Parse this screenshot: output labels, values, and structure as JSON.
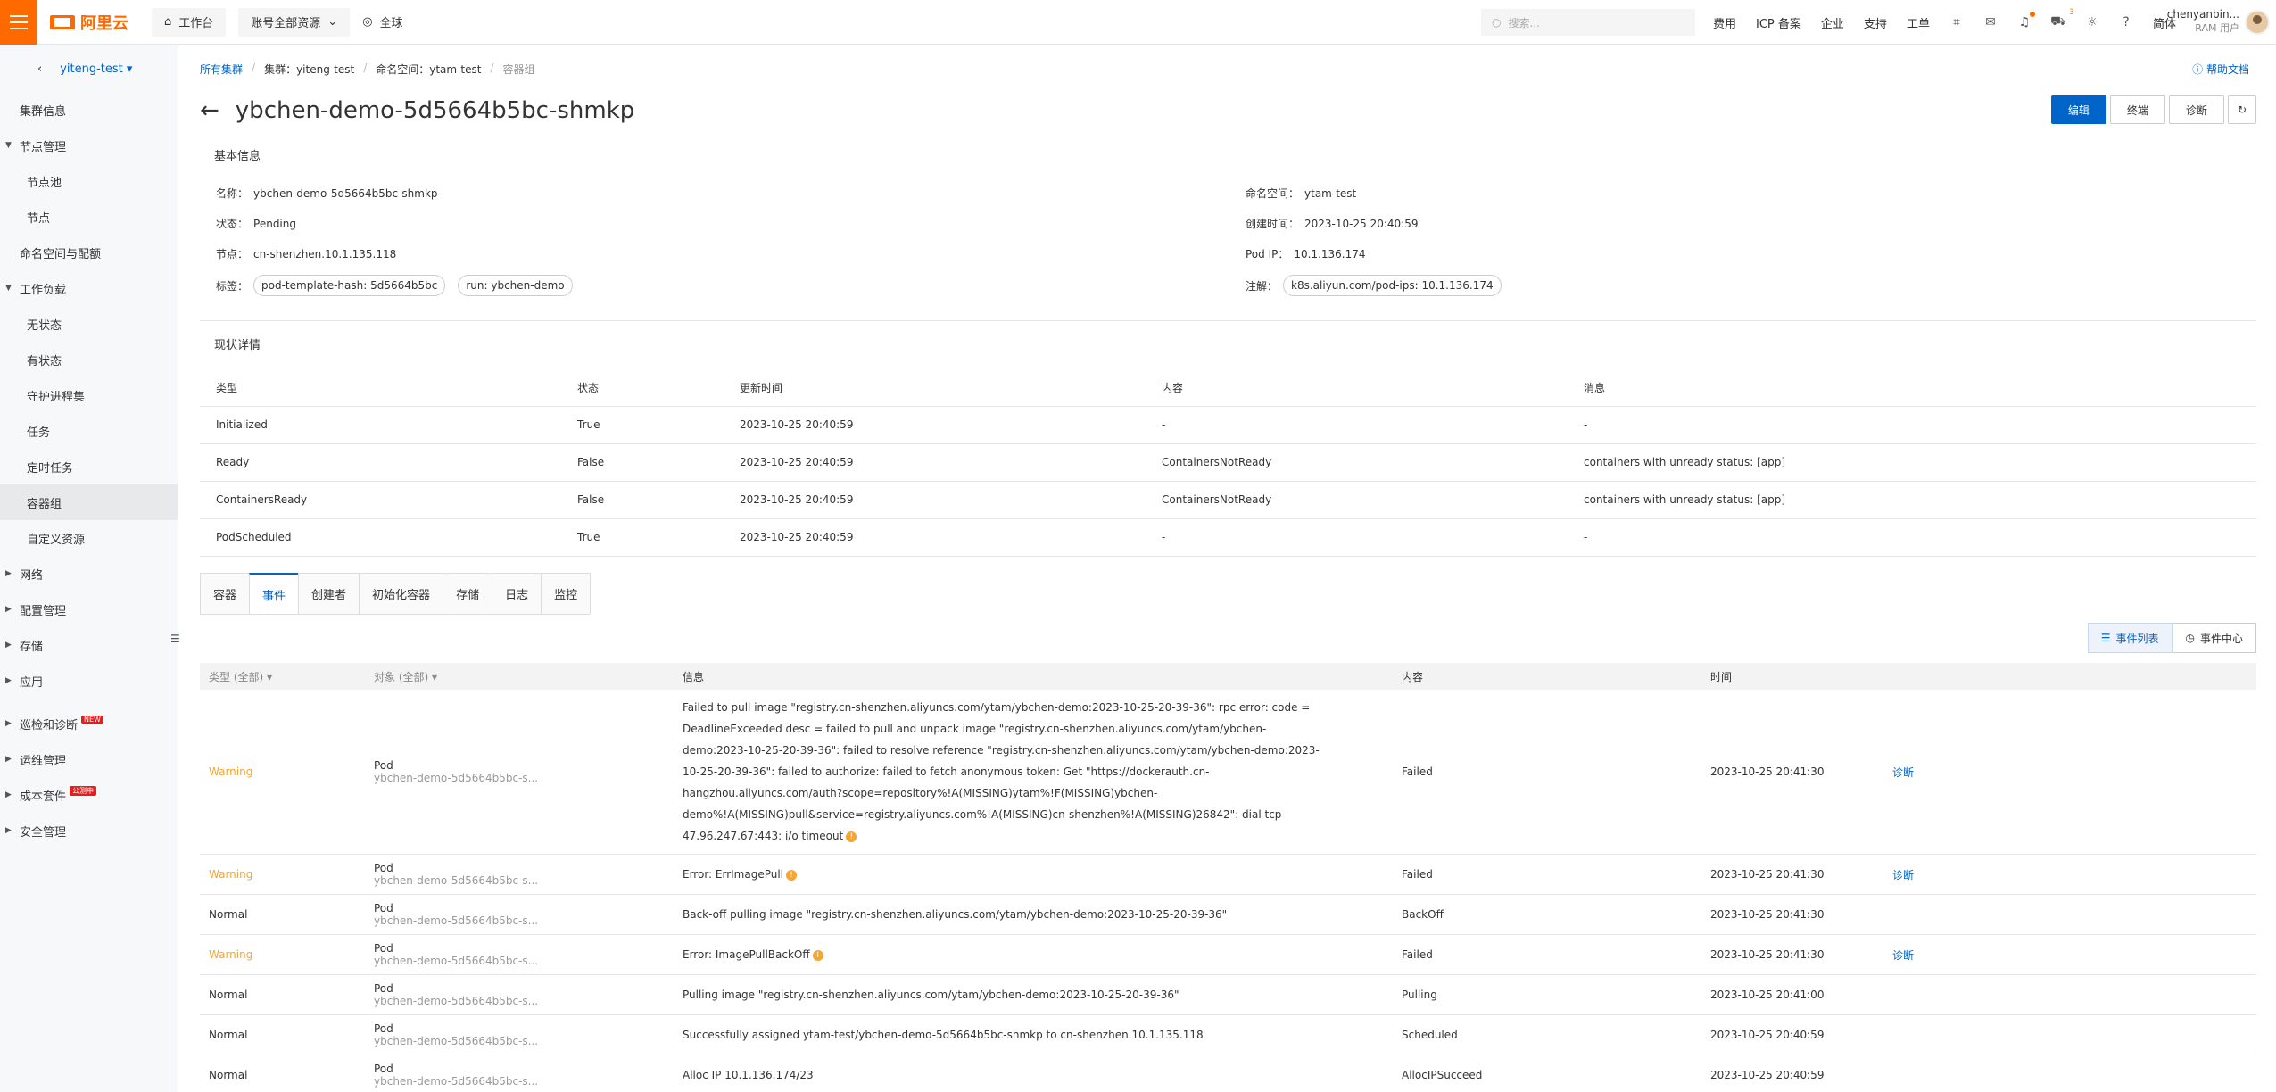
{
  "topbar": {
    "logo_text": "阿里云",
    "workbench": "工作台",
    "resource_scope": "账号全部资源",
    "region": "全球",
    "search_placeholder": "搜索...",
    "links": [
      "费用",
      "ICP 备案",
      "企业",
      "支持",
      "工单"
    ],
    "cart_count": "3",
    "lang": "简体",
    "user_name": "chenyanbin...",
    "user_role": "RAM 用户"
  },
  "sidebar": {
    "cluster": "yiteng-test",
    "items": [
      {
        "label": "集群信息"
      },
      {
        "label": "节点管理"
      },
      {
        "label": "节点池"
      },
      {
        "label": "节点"
      },
      {
        "label": "命名空间与配额"
      },
      {
        "label": "工作负载"
      },
      {
        "label": "无状态"
      },
      {
        "label": "有状态"
      },
      {
        "label": "守护进程集"
      },
      {
        "label": "任务"
      },
      {
        "label": "定时任务"
      },
      {
        "label": "容器组"
      },
      {
        "label": "自定义资源"
      },
      {
        "label": "网络"
      },
      {
        "label": "配置管理"
      },
      {
        "label": "存储"
      },
      {
        "label": "应用"
      },
      {
        "label": "巡检和诊断",
        "tag": "NEW"
      },
      {
        "label": "运维管理"
      },
      {
        "label": "成本套件",
        "tag": "公测中"
      },
      {
        "label": "安全管理"
      }
    ]
  },
  "breadcrumb": {
    "all_clusters": "所有集群",
    "cluster": "集群：yiteng-test",
    "namespace": "命名空间：ytam-test",
    "current": "容器组"
  },
  "help": "帮助文档",
  "page_title": "ybchen-demo-5d5664b5bc-shmkp",
  "actions": {
    "edit": "编辑",
    "drain": "终端",
    "diagnose": "诊断"
  },
  "basic": {
    "section_title": "基本信息",
    "name_k": "名称：",
    "name_v": "ybchen-demo-5d5664b5bc-shmkp",
    "status_k": "状态：",
    "status_v": "Pending",
    "node_k": "节点：",
    "node_v": "cn-shenzhen.10.1.135.118",
    "labels_k": "标签：",
    "labels": [
      "pod-template-hash: 5d5664b5bc",
      "run: ybchen-demo"
    ],
    "ns_k": "命名空间：",
    "ns_v": "ytam-test",
    "created_k": "创建时间：",
    "created_v": "2023-10-25 20:40:59",
    "podip_k": "Pod IP：",
    "podip_v": "10.1.136.174",
    "annot_k": "注解：",
    "annot": "k8s.aliyun.com/pod-ips: 10.1.136.174"
  },
  "conditions": {
    "section_title": "现状详情",
    "headers": [
      "类型",
      "状态",
      "更新时间",
      "内容",
      "消息"
    ],
    "rows": [
      [
        "Initialized",
        "True",
        "2023-10-25 20:40:59",
        "-",
        "-"
      ],
      [
        "Ready",
        "False",
        "2023-10-25 20:40:59",
        "ContainersNotReady",
        "containers with unready status: [app]"
      ],
      [
        "ContainersReady",
        "False",
        "2023-10-25 20:40:59",
        "ContainersNotReady",
        "containers with unready status: [app]"
      ],
      [
        "PodScheduled",
        "True",
        "2023-10-25 20:40:59",
        "-",
        "-"
      ]
    ]
  },
  "tabs": [
    "容器",
    "事件",
    "创建者",
    "初始化容器",
    "存储",
    "日志",
    "监控"
  ],
  "view_switch": {
    "list": "事件列表",
    "center": "事件中心"
  },
  "events": {
    "headers": [
      "类型 (全部)",
      "对象 (全部)",
      "信息",
      "内容",
      "时间",
      ""
    ],
    "rows": [
      {
        "type": "Warning",
        "obj": "Pod",
        "obj_sub": "ybchen-demo-5d5664b5bc-s...",
        "msg": "Failed to pull image \"registry.cn-shenzhen.aliyuncs.com/ytam/ybchen-demo:2023-10-25-20-39-36\": rpc error: code = DeadlineExceeded desc = failed to pull and unpack image \"registry.cn-shenzhen.aliyuncs.com/ytam/ybchen-demo:2023-10-25-20-39-36\": failed to resolve reference \"registry.cn-shenzhen.aliyuncs.com/ytam/ybchen-demo:2023-10-25-20-39-36\": failed to authorize: failed to fetch anonymous token: Get \"https://dockerauth.cn-hangzhou.aliyuncs.com/auth?scope=repository%!A(MISSING)ytam%!F(MISSING)ybchen-demo%!A(MISSING)pull&service=registry.aliyuncs.com%!A(MISSING)cn-shenzhen%!A(MISSING)26842\": dial tcp 47.96.247.67:443: i/o timeout",
        "content": "Failed",
        "time": "2023-10-25 20:41:30",
        "action": "诊断"
      },
      {
        "type": "Warning",
        "obj": "Pod",
        "obj_sub": "ybchen-demo-5d5664b5bc-s...",
        "msg": "Error: ErrImagePull",
        "content": "Failed",
        "time": "2023-10-25 20:41:30",
        "action": "诊断"
      },
      {
        "type": "Normal",
        "obj": "Pod",
        "obj_sub": "ybchen-demo-5d5664b5bc-s...",
        "msg": "Back-off pulling image \"registry.cn-shenzhen.aliyuncs.com/ytam/ybchen-demo:2023-10-25-20-39-36\"",
        "content": "BackOff",
        "time": "2023-10-25 20:41:30",
        "action": ""
      },
      {
        "type": "Warning",
        "obj": "Pod",
        "obj_sub": "ybchen-demo-5d5664b5bc-s...",
        "msg": "Error: ImagePullBackOff",
        "content": "Failed",
        "time": "2023-10-25 20:41:30",
        "action": "诊断"
      },
      {
        "type": "Normal",
        "obj": "Pod",
        "obj_sub": "ybchen-demo-5d5664b5bc-s...",
        "msg": "Pulling image \"registry.cn-shenzhen.aliyuncs.com/ytam/ybchen-demo:2023-10-25-20-39-36\"",
        "content": "Pulling",
        "time": "2023-10-25 20:41:00",
        "action": ""
      },
      {
        "type": "Normal",
        "obj": "Pod",
        "obj_sub": "ybchen-demo-5d5664b5bc-s...",
        "msg": "Successfully assigned ytam-test/ybchen-demo-5d5664b5bc-shmkp to cn-shenzhen.10.1.135.118",
        "content": "Scheduled",
        "time": "2023-10-25 20:40:59",
        "action": ""
      },
      {
        "type": "Normal",
        "obj": "Pod",
        "obj_sub": "ybchen-demo-5d5664b5bc-s...",
        "msg": "Alloc IP 10.1.136.174/23",
        "content": "AllocIPSucceed",
        "time": "2023-10-25 20:40:59",
        "action": ""
      }
    ]
  },
  "colors": {
    "brand": "#ff6a00",
    "primary": "#0064c8",
    "warning": "#f7a52f"
  }
}
